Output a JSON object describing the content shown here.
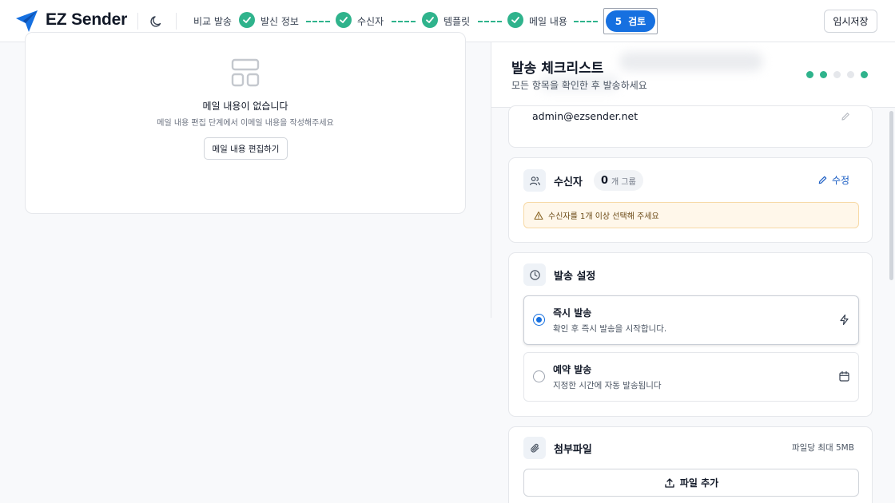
{
  "header": {
    "brand": "EZ Sender",
    "steps": [
      {
        "label": "비교 발송",
        "done": false
      },
      {
        "label": "발신 정보",
        "done": true
      },
      {
        "label": "수신자",
        "done": true
      },
      {
        "label": "템플릿",
        "done": true
      },
      {
        "label": "메일 내용",
        "done": true
      }
    ],
    "current_step": {
      "number": "5",
      "label": "검토"
    },
    "save_label": "임시저장"
  },
  "left": {
    "empty_title": "메일 내용이 없습니다",
    "empty_desc": "메일 내용 편집 단계에서 이메일 내용을 작성해주세요",
    "edit_button": "메일 내용 편집하기"
  },
  "checklist": {
    "title": "발송 체크리스트",
    "subtitle": "모든 항목을 확인한 후 발송하세요",
    "dots": [
      "#2fb38c",
      "#2fb38c",
      "#e5e7eb",
      "#e5e7eb",
      "#2fb38c"
    ]
  },
  "sender": {
    "email": "admin@ezsender.net"
  },
  "recipients": {
    "title": "수신자",
    "count": "0",
    "unit": "개 그룹",
    "edit_label": "수정",
    "warning": "수신자를 1개 이상 선택해 주세요"
  },
  "send_settings": {
    "title": "발송 설정",
    "options": [
      {
        "title": "즉시 발송",
        "desc": "확인 후 즉시 발송을 시작합니다.",
        "selected": true,
        "icon": "lightning-icon"
      },
      {
        "title": "예약 발송",
        "desc": "지정한 시간에 자동 발송됩니다",
        "selected": false,
        "icon": "calendar-icon"
      }
    ]
  },
  "attachments": {
    "title": "첨부파일",
    "limit": "파일당 최대 5MB",
    "add_label": "파일 추가"
  },
  "colors": {
    "accent": "#1670e0",
    "done": "#2fb38c",
    "warning_bg": "#fff7ea"
  }
}
